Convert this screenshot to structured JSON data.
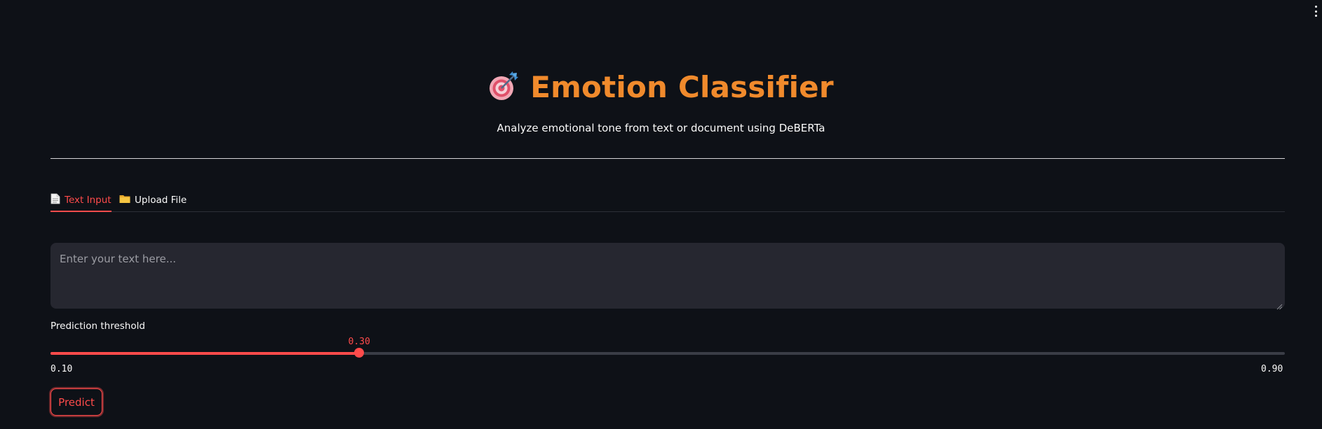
{
  "header": {
    "title": "Emotion Classifier",
    "title_icon": "target-icon",
    "subtitle": "Analyze emotional tone from text or document using DeBERTa"
  },
  "tabs": [
    {
      "label": "Text Input",
      "icon": "document-icon",
      "active": true
    },
    {
      "label": "Upload File",
      "icon": "folder-icon",
      "active": false
    }
  ],
  "text_input": {
    "value": "",
    "placeholder": "Enter your text here..."
  },
  "threshold": {
    "label": "Prediction threshold",
    "value": "0.30",
    "min": "0.10",
    "max": "0.90",
    "fraction": 0.25
  },
  "actions": {
    "predict_label": "Predict"
  },
  "colors": {
    "accent": "#ff4b4b",
    "title": "#f08a2c",
    "background": "#0e1117",
    "input_bg": "#262730"
  }
}
